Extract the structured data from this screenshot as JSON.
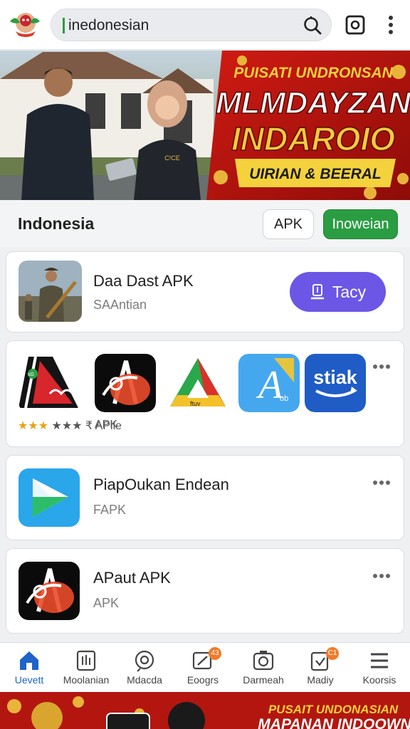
{
  "search": {
    "query": "inedonesian"
  },
  "banner": {
    "line1": "PUISATI UNDRONSAN",
    "line2": "MLMDAYZAN",
    "line3": "INDAROIO",
    "ribbon": "UIRIAN & BEERAL",
    "badge_text": "C!CE"
  },
  "section": {
    "title": "Indonesia",
    "chip_apk": "APK",
    "chip_lang": "Inoweian"
  },
  "featured": {
    "title": "Daa Dast APK",
    "subtitle": "SAAntian",
    "button": "Tacy"
  },
  "grid": {
    "items": [
      {
        "label": "★★★ ₹ APlle",
        "glyph": "sG"
      },
      {
        "label": "APK"
      },
      {
        "label": "",
        "glyph": "ftuv"
      },
      {
        "label": "",
        "glyph": "A",
        "mark": "ob"
      },
      {
        "label": "",
        "glyph": "stiak"
      }
    ]
  },
  "list": [
    {
      "title": "PiapOukan Endean",
      "subtitle": "FAPK"
    },
    {
      "title": "APaut APK",
      "subtitle": "APK"
    }
  ],
  "nav": [
    {
      "label": "Uevett",
      "icon": "home-icon",
      "active": true
    },
    {
      "label": "Moolanian",
      "icon": "grid-icon"
    },
    {
      "label": "Mdacda",
      "icon": "compass-icon"
    },
    {
      "label": "Eoogrs",
      "icon": "edit-icon",
      "badge": "43"
    },
    {
      "label": "Darmeah",
      "icon": "camera-icon"
    },
    {
      "label": "Madiy",
      "icon": "download-icon",
      "badge": "C1"
    },
    {
      "label": "Koorsis",
      "icon": "menu-icon"
    }
  ],
  "ad": {
    "line1": "PUSAIT UNDONASIAN",
    "line2": "MAPANAN INDOOWN"
  },
  "colors": {
    "accent_green": "#2a9d42",
    "button_purple": "#6b56e6",
    "nav_active": "#1d63c9"
  }
}
